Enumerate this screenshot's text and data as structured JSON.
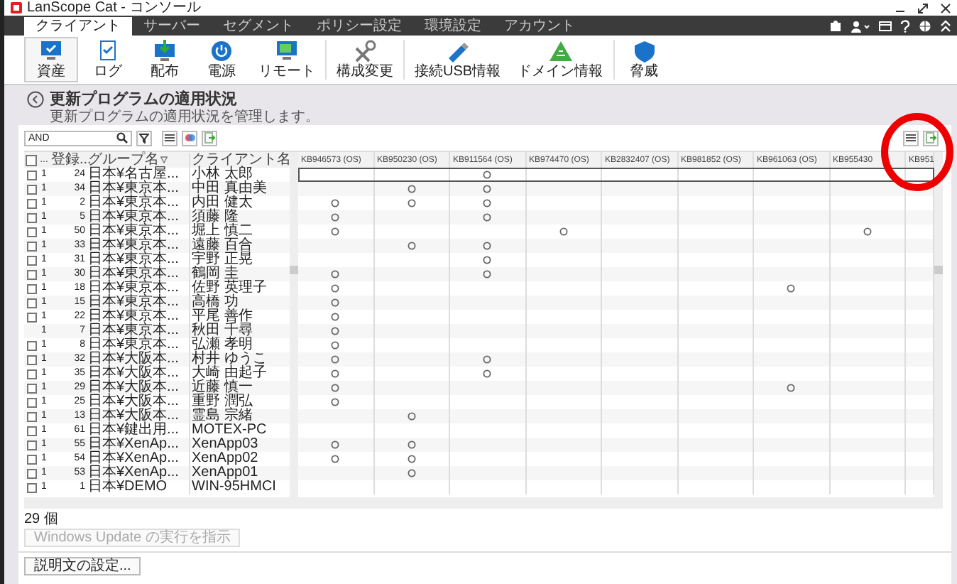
{
  "window": {
    "title": "LanScope Cat - コンソール"
  },
  "tabs": [
    {
      "label": "クライアント",
      "selected": true
    },
    {
      "label": "サーバー",
      "selected": false
    },
    {
      "label": "セグメント",
      "selected": false
    },
    {
      "label": "ポリシー設定",
      "selected": false
    },
    {
      "label": "環境設定",
      "selected": false
    },
    {
      "label": "アカウント",
      "selected": false
    }
  ],
  "toolbar": [
    {
      "label": "資産",
      "kind": "asset",
      "selected": true
    },
    {
      "label": "ログ",
      "kind": "log",
      "selected": false
    },
    {
      "label": "配布",
      "kind": "distribute",
      "selected": false
    },
    {
      "label": "電源",
      "kind": "power",
      "selected": false
    },
    {
      "label": "リモート",
      "kind": "remote",
      "selected": false
    },
    {
      "label": "構成変更",
      "kind": "config",
      "selected": false
    },
    {
      "label": "接続USB情報",
      "kind": "usb",
      "selected": false
    },
    {
      "label": "ドメイン情報",
      "kind": "domain",
      "selected": false
    },
    {
      "label": "脅威",
      "kind": "threat",
      "selected": false
    }
  ],
  "page": {
    "title": "更新プログラムの適用状況",
    "subtitle": "更新プログラムの適用状況を管理します。"
  },
  "search": {
    "value": "AND"
  },
  "grid": {
    "select_all": {
      "checked": false
    },
    "fixed_columns": [
      "...",
      "登録...",
      "グループ名",
      "クライアント名"
    ],
    "update_columns": [
      "KB946573 (OS)",
      "KB950230 (OS)",
      "KB911564 (OS)",
      "KB974470 (OS)",
      "KB2832407 (OS)",
      "KB981852 (OS)",
      "KB961063 (OS)",
      "KB955430",
      "KB951"
    ],
    "rows": [
      {
        "checkbox": true,
        "checked": false,
        "focused": true,
        "column_2": "1",
        "number": "24",
        "group": "日本¥名古屋...",
        "client": "小林 太郎",
        "applied": [
          false,
          false,
          true,
          false,
          false,
          false,
          false,
          false,
          false
        ]
      },
      {
        "checkbox": true,
        "checked": false,
        "focused": false,
        "column_2": "1",
        "number": "34",
        "group": "日本¥東京本...",
        "client": "中田 真由美",
        "applied": [
          false,
          true,
          true,
          false,
          false,
          false,
          false,
          false,
          false
        ]
      },
      {
        "checkbox": true,
        "checked": false,
        "focused": false,
        "column_2": "1",
        "number": "2",
        "group": "日本¥東京本...",
        "client": "内田 健太",
        "applied": [
          true,
          true,
          true,
          false,
          false,
          false,
          false,
          false,
          false
        ]
      },
      {
        "checkbox": true,
        "checked": false,
        "focused": false,
        "column_2": "1",
        "number": "5",
        "group": "日本¥東京本...",
        "client": "須藤 隆",
        "applied": [
          true,
          false,
          true,
          false,
          false,
          false,
          false,
          false,
          false
        ]
      },
      {
        "checkbox": true,
        "checked": false,
        "focused": false,
        "column_2": "1",
        "number": "50",
        "group": "日本¥東京本...",
        "client": "堀上 慎二",
        "applied": [
          true,
          false,
          false,
          true,
          false,
          false,
          false,
          true,
          false
        ]
      },
      {
        "checkbox": true,
        "checked": false,
        "focused": false,
        "column_2": "1",
        "number": "33",
        "group": "日本¥東京本...",
        "client": "遠藤 百合",
        "applied": [
          false,
          true,
          true,
          false,
          false,
          false,
          false,
          false,
          false
        ]
      },
      {
        "checkbox": true,
        "checked": false,
        "focused": false,
        "column_2": "1",
        "number": "31",
        "group": "日本¥東京本...",
        "client": "宇野 正晃",
        "applied": [
          false,
          false,
          true,
          false,
          false,
          false,
          false,
          false,
          false
        ]
      },
      {
        "checkbox": true,
        "checked": false,
        "focused": false,
        "column_2": "1",
        "number": "30",
        "group": "日本¥東京本...",
        "client": "鶴岡 圭",
        "applied": [
          true,
          false,
          true,
          false,
          false,
          false,
          false,
          false,
          false
        ]
      },
      {
        "checkbox": true,
        "checked": false,
        "focused": false,
        "column_2": "1",
        "number": "18",
        "group": "日本¥東京本...",
        "client": "佐野 英理子",
        "applied": [
          true,
          false,
          false,
          false,
          false,
          false,
          true,
          false,
          false
        ]
      },
      {
        "checkbox": true,
        "checked": false,
        "focused": false,
        "column_2": "1",
        "number": "15",
        "group": "日本¥東京本...",
        "client": "高橋 功",
        "applied": [
          true,
          false,
          false,
          false,
          false,
          false,
          false,
          false,
          false
        ]
      },
      {
        "checkbox": true,
        "checked": false,
        "focused": false,
        "column_2": "1",
        "number": "22",
        "group": "日本¥東京本...",
        "client": "平尾 善作",
        "applied": [
          true,
          false,
          false,
          false,
          false,
          false,
          false,
          false,
          false
        ]
      },
      {
        "checkbox": false,
        "focused": false,
        "column_2": "1",
        "number": "7",
        "group": "日本¥東京本...",
        "client": "秋田 千尋",
        "applied": [
          true,
          false,
          false,
          false,
          false,
          false,
          false,
          false,
          false
        ]
      },
      {
        "checkbox": true,
        "checked": false,
        "focused": false,
        "column_2": "1",
        "number": "8",
        "group": "日本¥東京本...",
        "client": "弘瀬 孝明",
        "applied": [
          true,
          false,
          false,
          false,
          false,
          false,
          false,
          false,
          false
        ]
      },
      {
        "checkbox": true,
        "checked": false,
        "focused": false,
        "column_2": "1",
        "number": "32",
        "group": "日本¥大阪本...",
        "client": "村井 ゆうこ",
        "applied": [
          true,
          false,
          true,
          false,
          false,
          false,
          false,
          false,
          false
        ]
      },
      {
        "checkbox": true,
        "checked": false,
        "focused": false,
        "column_2": "1",
        "number": "35",
        "group": "日本¥大阪本...",
        "client": "大崎 由起子",
        "applied": [
          true,
          false,
          true,
          false,
          false,
          false,
          false,
          false,
          false
        ]
      },
      {
        "checkbox": true,
        "checked": false,
        "focused": false,
        "column_2": "1",
        "number": "29",
        "group": "日本¥大阪本...",
        "client": "近藤 慎一",
        "applied": [
          true,
          false,
          false,
          false,
          false,
          false,
          true,
          false,
          false
        ]
      },
      {
        "checkbox": true,
        "checked": false,
        "focused": false,
        "column_2": "1",
        "number": "25",
        "group": "日本¥大阪本...",
        "client": "重野 潤弘",
        "applied": [
          true,
          false,
          false,
          false,
          false,
          false,
          false,
          false,
          false
        ]
      },
      {
        "checkbox": true,
        "checked": false,
        "focused": false,
        "column_2": "1",
        "number": "13",
        "group": "日本¥大阪本...",
        "client": "霊島 宗緒",
        "applied": [
          false,
          true,
          false,
          false,
          false,
          false,
          false,
          false,
          false
        ]
      },
      {
        "checkbox": true,
        "checked": false,
        "focused": false,
        "column_2": "1",
        "number": "61",
        "group": "日本¥鍵出用...",
        "client": "MOTEX-PC",
        "applied": [
          false,
          false,
          false,
          false,
          false,
          false,
          false,
          false,
          false
        ]
      },
      {
        "checkbox": true,
        "checked": false,
        "focused": false,
        "column_2": "1",
        "number": "55",
        "group": "日本¥XenAp...",
        "client": "XenApp03",
        "applied": [
          true,
          true,
          false,
          false,
          false,
          false,
          false,
          false,
          false
        ]
      },
      {
        "checkbox": true,
        "checked": false,
        "focused": false,
        "column_2": "1",
        "number": "54",
        "group": "日本¥XenAp...",
        "client": "XenApp02",
        "applied": [
          true,
          true,
          false,
          false,
          false,
          false,
          false,
          false,
          false
        ]
      },
      {
        "checkbox": true,
        "checked": false,
        "focused": false,
        "column_2": "1",
        "number": "53",
        "group": "日本¥XenAp...",
        "client": "XenApp01",
        "applied": [
          false,
          true,
          false,
          false,
          false,
          false,
          false,
          false,
          false
        ]
      },
      {
        "checkbox": true,
        "checked": false,
        "focused": false,
        "column_2": "1",
        "number": "1",
        "group": "日本¥DEMO",
        "client": "WIN-95HMCI",
        "applied": [
          false,
          false,
          false,
          false,
          false,
          false,
          false,
          false,
          false
        ]
      }
    ]
  },
  "count": "29 個",
  "buttons": [
    {
      "label": "Windows Update の実行を指示",
      "disabled": true
    },
    {
      "label": "説明文の設定...",
      "disabled": false
    }
  ]
}
